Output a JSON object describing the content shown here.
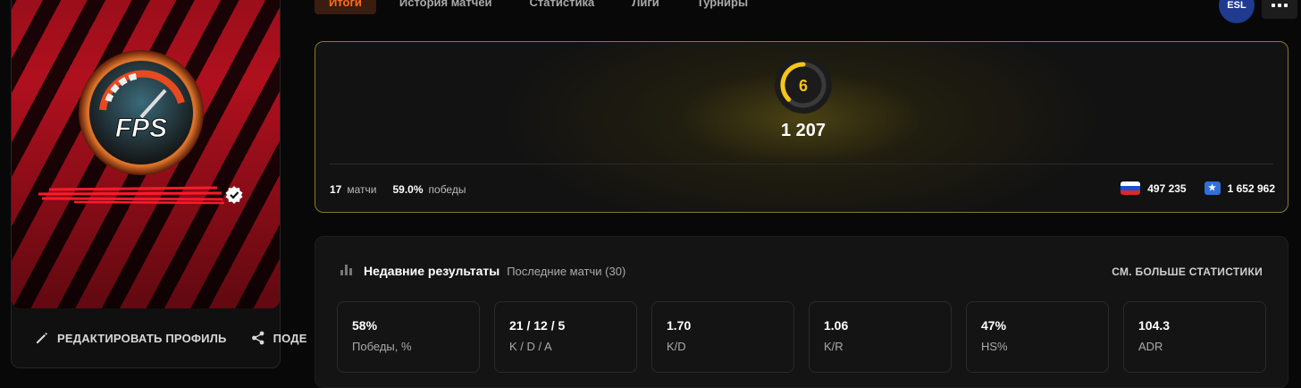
{
  "profile": {
    "avatar_text": "FPS",
    "edit_label": "РЕДАКТИРОВАТЬ ПРОФИЛЬ",
    "share_label": "ПОДЕ"
  },
  "tabs": [
    {
      "label": "Итоги",
      "active": true
    },
    {
      "label": "История матчей",
      "active": false
    },
    {
      "label": "Статистика",
      "active": false
    },
    {
      "label": "Лиги",
      "active": false
    },
    {
      "label": "Турниры",
      "active": false
    }
  ],
  "elo": {
    "level": "6",
    "value": "1 207",
    "matches_count": "17",
    "matches_label": "матчи",
    "winrate": "59.0%",
    "winrate_label": "победы",
    "country_rank": "497 235",
    "region_rank": "1 652 962",
    "accent_color": "#f5c518"
  },
  "recent": {
    "title": "Недавние результаты",
    "subtitle": "Последние матчи (30)",
    "see_more": "СМ. БОЛЬШЕ СТАТИСТИКИ",
    "stats": [
      {
        "value": "58%",
        "label": "Победы, %"
      },
      {
        "value": "21 / 12 / 5",
        "label": "K / D / A"
      },
      {
        "value": "1.70",
        "label": "K/D"
      },
      {
        "value": "1.06",
        "label": "K/R"
      },
      {
        "value": "47%",
        "label": "HS%"
      },
      {
        "value": "104.3",
        "label": "ADR"
      }
    ]
  },
  "icons": {
    "edit": "pencil-icon",
    "share": "share-icon",
    "verified": "verified-icon",
    "country": "russia-flag-icon",
    "region": "region-icon",
    "stats": "bar-chart-icon"
  }
}
